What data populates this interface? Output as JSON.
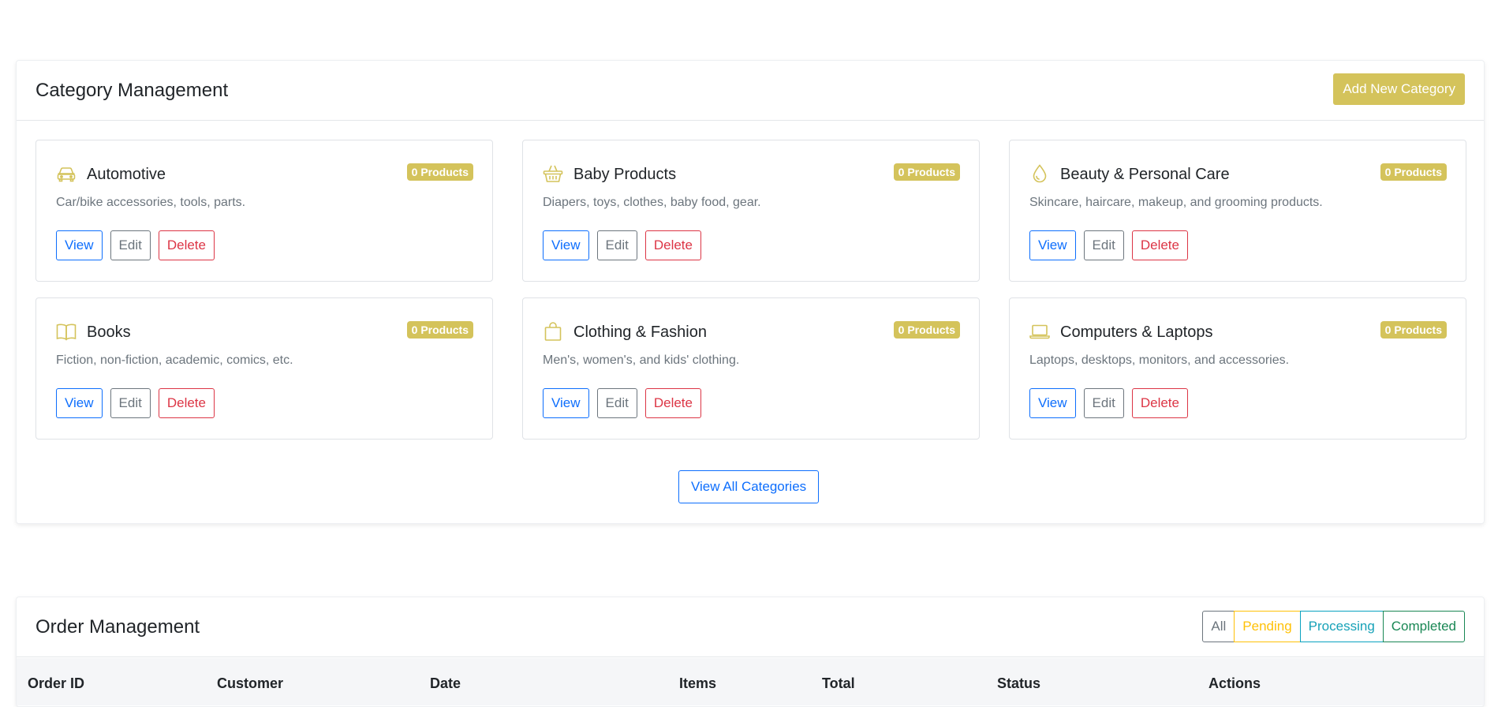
{
  "categories_section": {
    "title": "Category Management",
    "add_button": "Add New Category",
    "view_all_button": "View All Categories",
    "items": [
      {
        "name": "Automotive",
        "badge": "0 Products",
        "description": "Car/bike accessories, tools, parts.",
        "icon": "car-icon",
        "view": "View",
        "edit": "Edit",
        "delete": "Delete"
      },
      {
        "name": "Baby Products",
        "badge": "0 Products",
        "description": "Diapers, toys, clothes, baby food, gear.",
        "icon": "basket-icon",
        "view": "View",
        "edit": "Edit",
        "delete": "Delete"
      },
      {
        "name": "Beauty & Personal Care",
        "badge": "0 Products",
        "description": "Skincare, haircare, makeup, and grooming products.",
        "icon": "droplet-icon",
        "view": "View",
        "edit": "Edit",
        "delete": "Delete"
      },
      {
        "name": "Books",
        "badge": "0 Products",
        "description": "Fiction, non-fiction, academic, comics, etc.",
        "icon": "book-icon",
        "view": "View",
        "edit": "Edit",
        "delete": "Delete"
      },
      {
        "name": "Clothing & Fashion",
        "badge": "0 Products",
        "description": "Men's, women's, and kids' clothing.",
        "icon": "bag-icon",
        "view": "View",
        "edit": "Edit",
        "delete": "Delete"
      },
      {
        "name": "Computers & Laptops",
        "badge": "0 Products",
        "description": "Laptops, desktops, monitors, and accessories.",
        "icon": "laptop-icon",
        "view": "View",
        "edit": "Edit",
        "delete": "Delete"
      }
    ]
  },
  "orders_section": {
    "title": "Order Management",
    "filters": [
      "All",
      "Pending",
      "Processing",
      "Completed"
    ],
    "columns": [
      "Order ID",
      "Customer",
      "Date",
      "Items",
      "Total",
      "Status",
      "Actions"
    ]
  },
  "colors": {
    "accent": "#d4c35b",
    "primary": "#0d6efd",
    "secondary": "#6c757d",
    "danger": "#dc3545",
    "warning": "#ffc107",
    "info": "#17a2b8",
    "success": "#198754"
  }
}
